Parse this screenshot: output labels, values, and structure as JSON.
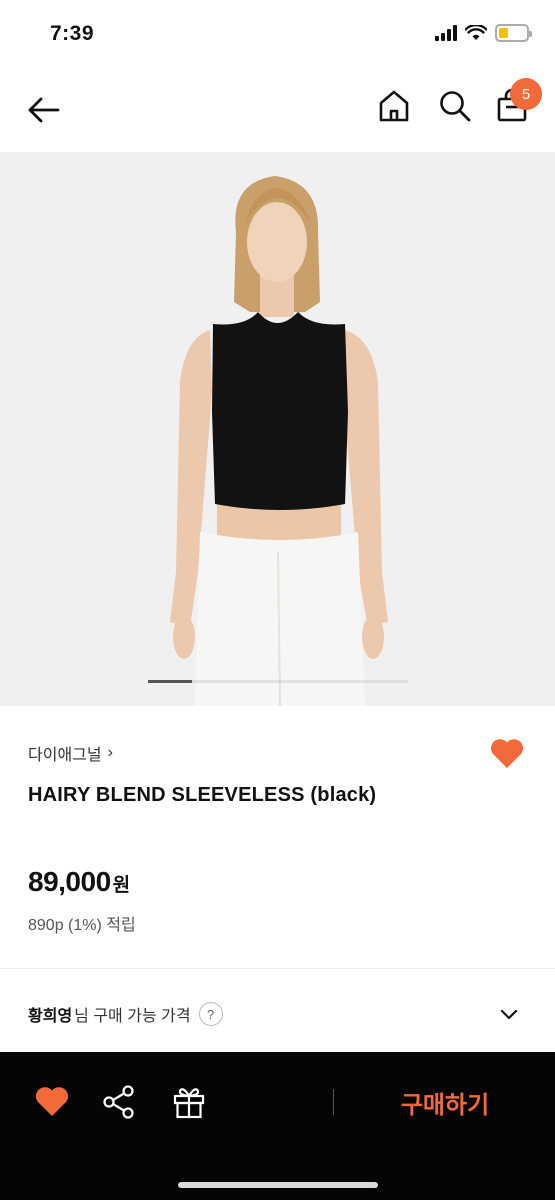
{
  "status_bar": {
    "time": "7:39"
  },
  "header": {
    "cart_count": "5"
  },
  "product": {
    "brand": "다이애그널",
    "brand_chevron": "›",
    "title": "HAIRY BLEND SLEEVELESS (black)",
    "price": "89,000",
    "price_unit": "원",
    "points": "890p (1%) 적립",
    "buy_price_name": "황희영",
    "buy_price_label": "님 구매 가능 가격",
    "help_mark": "?"
  },
  "carousel": {
    "progress": 0.17
  },
  "bottom_bar": {
    "buy_label": "구매하기"
  },
  "colors": {
    "accent": "#f26a3a",
    "bottom_bar_bg": "#050505"
  },
  "icons": [
    "back-arrow-icon",
    "home-icon",
    "search-icon",
    "shopping-bag-icon",
    "heart-icon",
    "share-icon",
    "gift-icon",
    "chevron-down-icon",
    "help-icon"
  ]
}
